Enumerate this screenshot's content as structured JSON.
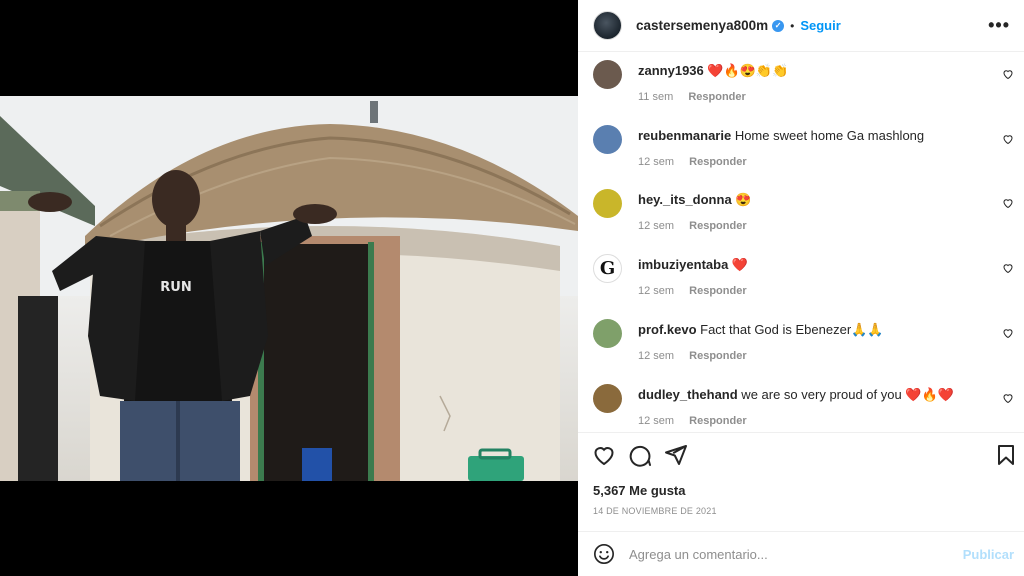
{
  "post": {
    "username": "castersemenya800m",
    "verified_mark": "✓",
    "separator": "•",
    "follow_label": "Seguir",
    "more_label": "•••",
    "likes": "5,367 Me gusta",
    "date": "14 DE NOVIEMBRE DE 2021"
  },
  "comments": [
    {
      "user": "zanny1936",
      "text": " ❤️🔥😍👏👏",
      "time": "11 sem",
      "reply": "Responder",
      "avatar_color": "#6b5a4e"
    },
    {
      "user": "reubenmanarie",
      "text": " Home sweet home Ga mashlong",
      "time": "12 sem",
      "reply": "Responder",
      "avatar_color": "#5a7fb0"
    },
    {
      "user": "hey._its_donna",
      "text": " 😍",
      "time": "12 sem",
      "reply": "Responder",
      "avatar_color": "#c9b62a"
    },
    {
      "user": "imbuziyentaba",
      "text": " ❤️",
      "time": "12 sem",
      "reply": "Responder",
      "avatar_color": "#ffffff",
      "avatar_letter": "G"
    },
    {
      "user": "prof.kevo",
      "text": " Fact that God is Ebenezer🙏🙏",
      "time": "12 sem",
      "reply": "Responder",
      "avatar_color": "#7fa06a"
    },
    {
      "user": "dudley_thehand",
      "text": " we are so very proud of you ❤️🔥❤️",
      "time": "12 sem",
      "reply": "Responder",
      "avatar_color": "#8a6a3c"
    }
  ],
  "composer": {
    "placeholder": "Agrega un comentario...",
    "publish_label": "Publicar"
  },
  "icons": {
    "like": "heart-icon",
    "comment": "comment-icon",
    "share": "send-icon",
    "save": "bookmark-icon",
    "emoji": "emoji-icon"
  },
  "photo": {
    "shirt_text": "RUN"
  },
  "colors": {
    "accent": "#0095f6",
    "publish_disabled": "#b2dffc",
    "meta": "#8e8e8e"
  }
}
